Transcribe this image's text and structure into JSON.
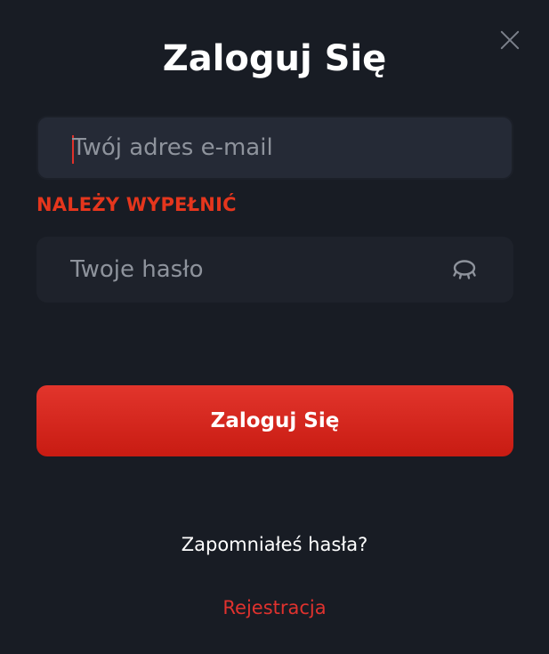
{
  "modal": {
    "title": "Zaloguj Się",
    "close_icon": "close-icon"
  },
  "email_field": {
    "placeholder": "Twój adres e-mail",
    "value": ""
  },
  "email_error": "NALEŻY WYPEŁNIĆ",
  "password_field": {
    "placeholder": "Twoje hasło",
    "value": "",
    "toggle_icon": "eye-closed-icon"
  },
  "submit_label": "Zaloguj Się",
  "forgot_password_label": "Zapomniałeś hasła?",
  "register_label": "Rejestracja",
  "colors": {
    "background": "#181c24",
    "accent": "#e0312a",
    "error": "#e5361d",
    "field_bg": "#252a36"
  }
}
